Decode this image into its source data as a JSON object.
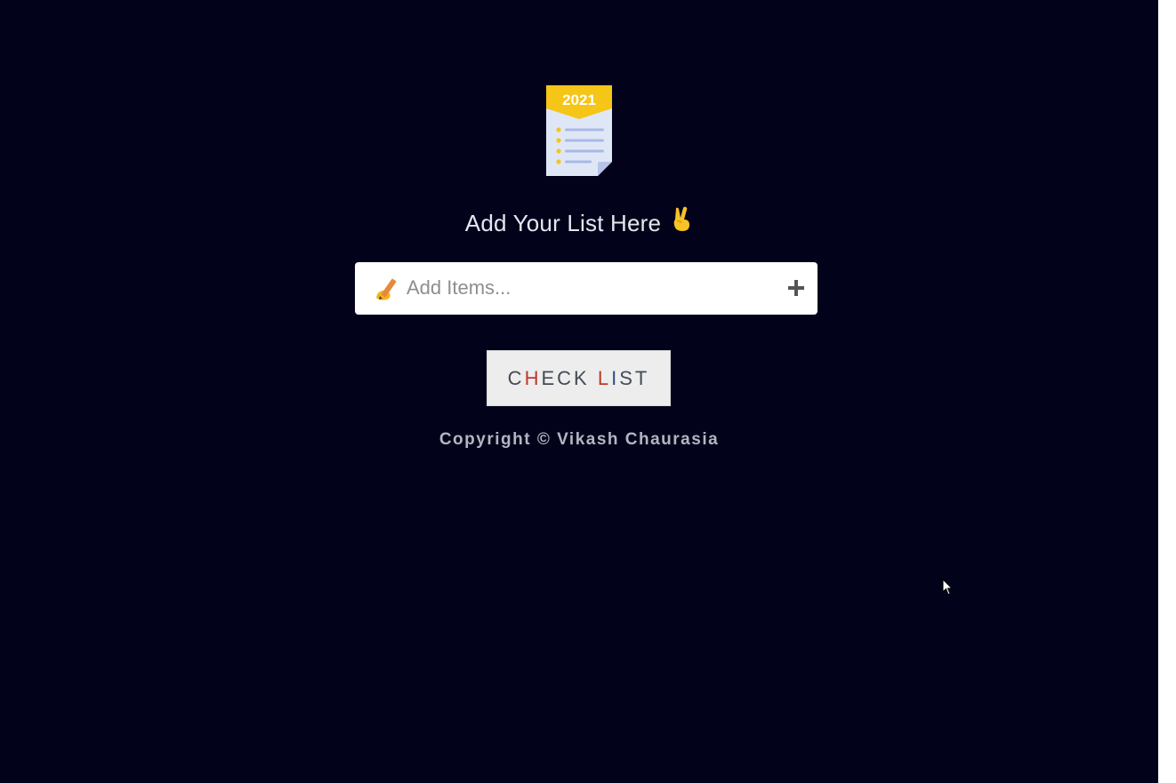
{
  "logo": {
    "year": "2021",
    "icon": "checklist-notepad-icon"
  },
  "heading": {
    "text": "Add Your List Here",
    "emoji": "✌"
  },
  "input": {
    "placeholder": "Add Items...",
    "value": "",
    "icon": "writing-hand-icon",
    "add_icon": "plus-icon",
    "add_glyph": "+"
  },
  "check_button": {
    "label_part1": "C",
    "label_part2": "H",
    "label_part3": "ECK ",
    "label_part4": "L",
    "label_part5": "I",
    "label_part6": "ST"
  },
  "footer": {
    "copyright": "Copyright © Vikash Chaurasia"
  },
  "colors": {
    "background": "#02031a",
    "logo_banner": "#f5c518",
    "logo_paper": "#dfe7f7",
    "logo_lines": "#a9b8e6",
    "button_bg": "#ededed"
  }
}
